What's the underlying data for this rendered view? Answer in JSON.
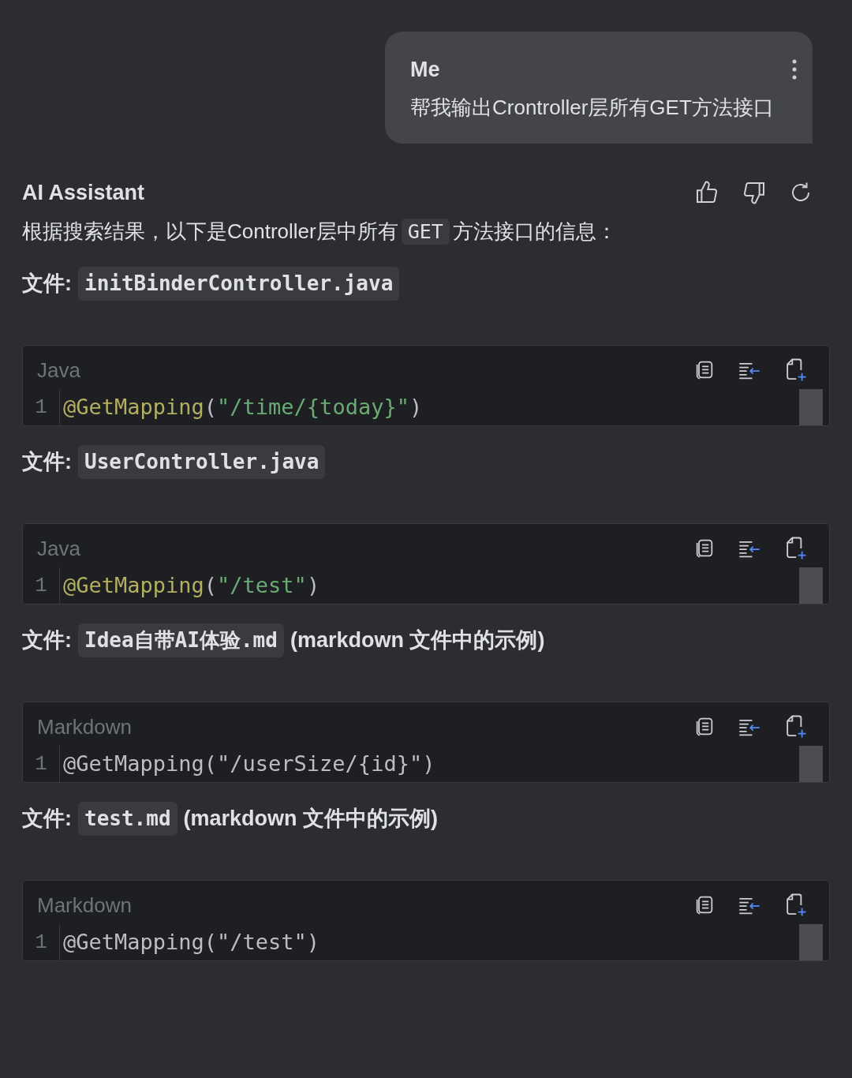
{
  "user_message": {
    "author": "Me",
    "text": "帮我输出Crontroller层所有GET方法接口"
  },
  "assistant": {
    "author": "AI Assistant",
    "intro": [
      {
        "kind": "text",
        "text": "根据搜索结果，以下是Controller层中所有"
      },
      {
        "kind": "code",
        "text": "GET"
      },
      {
        "kind": "text",
        "text": "方法接口的信息："
      }
    ],
    "sections": [
      {
        "label": "文件:",
        "file": "initBinderController.java",
        "code_block": {
          "language": "Java",
          "lines": [
            {
              "number": "1",
              "tokens": [
                {
                  "kind": "annotation",
                  "text": "@GetMapping"
                },
                {
                  "kind": "plain",
                  "text": "("
                },
                {
                  "kind": "string",
                  "text": "\"/time/{today}\""
                },
                {
                  "kind": "plain",
                  "text": ")"
                }
              ]
            }
          ]
        }
      },
      {
        "label": "文件:",
        "file": "UserController.java",
        "code_block": {
          "language": "Java",
          "lines": [
            {
              "number": "1",
              "tokens": [
                {
                  "kind": "annotation",
                  "text": "@GetMapping"
                },
                {
                  "kind": "plain",
                  "text": "("
                },
                {
                  "kind": "string",
                  "text": "\"/test\""
                },
                {
                  "kind": "plain",
                  "text": ")"
                }
              ]
            }
          ]
        }
      },
      {
        "label": "文件:",
        "file": "Idea自带AI体验.md",
        "note": "(markdown 文件中的示例)",
        "code_block": {
          "language": "Markdown",
          "lines": [
            {
              "number": "1",
              "tokens": [
                {
                  "kind": "plain",
                  "text": "@GetMapping(\"/userSize/{id}\")"
                }
              ]
            }
          ]
        }
      },
      {
        "label": "文件:",
        "file": "test.md",
        "note": "(markdown 文件中的示例)",
        "code_block": {
          "language": "Markdown",
          "lines": [
            {
              "number": "1",
              "tokens": [
                {
                  "kind": "plain",
                  "text": "@GetMapping(\"/test\")"
                }
              ]
            }
          ]
        }
      }
    ]
  }
}
